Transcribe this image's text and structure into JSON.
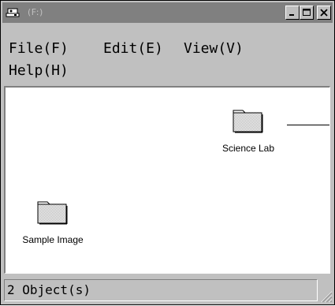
{
  "window": {
    "title": "(F:)",
    "title_icon": "drive-icon",
    "controls": {
      "minimize_icon": "minimize-icon",
      "maximize_icon": "maximize-icon",
      "close_icon": "close-icon"
    }
  },
  "menubar": {
    "items": [
      {
        "label": "File(F)"
      },
      {
        "label": "Edit(E)"
      },
      {
        "label": "View(V)"
      },
      {
        "label": "Help(H)"
      }
    ]
  },
  "content": {
    "folders": [
      {
        "label": "Science Lab",
        "icon": "folder-icon"
      },
      {
        "label": "Sample Image",
        "icon": "folder-icon"
      }
    ]
  },
  "statusbar": {
    "text": "2 Object(s)"
  },
  "colors": {
    "face": "#c0c0c0",
    "titlebar_inactive": "#808080",
    "client": "#ffffff"
  }
}
